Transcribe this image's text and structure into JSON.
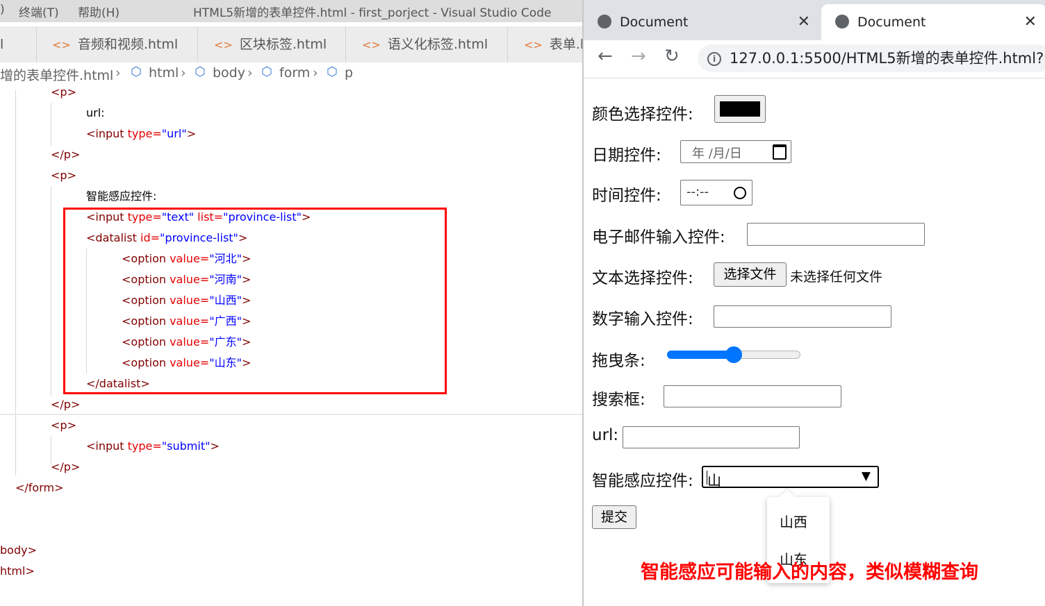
{
  "vscode": {
    "menu": [
      "终端(T)",
      "帮助(H)"
    ],
    "title": "HTML5新增的表单控件.html - first_porject - Visual Studio Code",
    "tabs": [
      "音频和视频.html",
      "区块标签.html",
      "语义化标签.html",
      "表单.ht"
    ],
    "breadcrumb": [
      "增的表单控件.html",
      "html",
      "body",
      "form",
      "p"
    ],
    "code": {
      "p_open": "<p>",
      "p_close": "</p>",
      "url_text": "url:",
      "url_input": [
        "<input",
        " type=",
        "\"url\"",
        ">"
      ],
      "smart_text": "智能感应控件:",
      "text_input": [
        "<input",
        " type=",
        "\"text\"",
        " list=",
        "\"province-list\"",
        ">"
      ],
      "datalist_open": [
        "<datalist",
        " id=",
        "\"province-list\"",
        ">"
      ],
      "options": [
        "河北",
        "河南",
        "山西",
        "广西",
        "广东",
        "山东"
      ],
      "option_tag": "<option",
      "option_attr": " value=",
      "option_end": ">",
      "datalist_close": "</datalist>",
      "submit_input": [
        "<input",
        " type=",
        "\"submit\"",
        ">"
      ],
      "form_close": "</form>",
      "body_close": "body>",
      "html_close": "html>"
    }
  },
  "browser": {
    "tabs": [
      "Document",
      "Document"
    ],
    "url": "127.0.0.1:5500/HTML5新增的表单控件.html?",
    "form": {
      "color_label": "颜色选择控件:",
      "color_value": "#000000",
      "date_label": "日期控件:",
      "date_placeholder": "年 /月/日",
      "time_label": "时间控件:",
      "time_placeholder": "--:--",
      "email_label": "电子邮件输入控件:",
      "file_label": "文本选择控件:",
      "file_button": "选择文件",
      "file_status": "未选择任何文件",
      "number_label": "数字输入控件:",
      "range_label": "拖曳条:",
      "range_value": 0.5,
      "search_label": "搜索框:",
      "url_label": "url:",
      "smart_label": "智能感应控件:",
      "smart_value": "山",
      "submit": "提交",
      "suggestions": [
        "山西",
        "山东"
      ]
    },
    "annotation": "智能感应可能输入的内容，类似模糊查询"
  },
  "colors": {
    "accent": "#0075ff",
    "highlight_box": "#ff0000",
    "tag": "#800000",
    "attr": "#e50000",
    "value": "#0000ff"
  }
}
